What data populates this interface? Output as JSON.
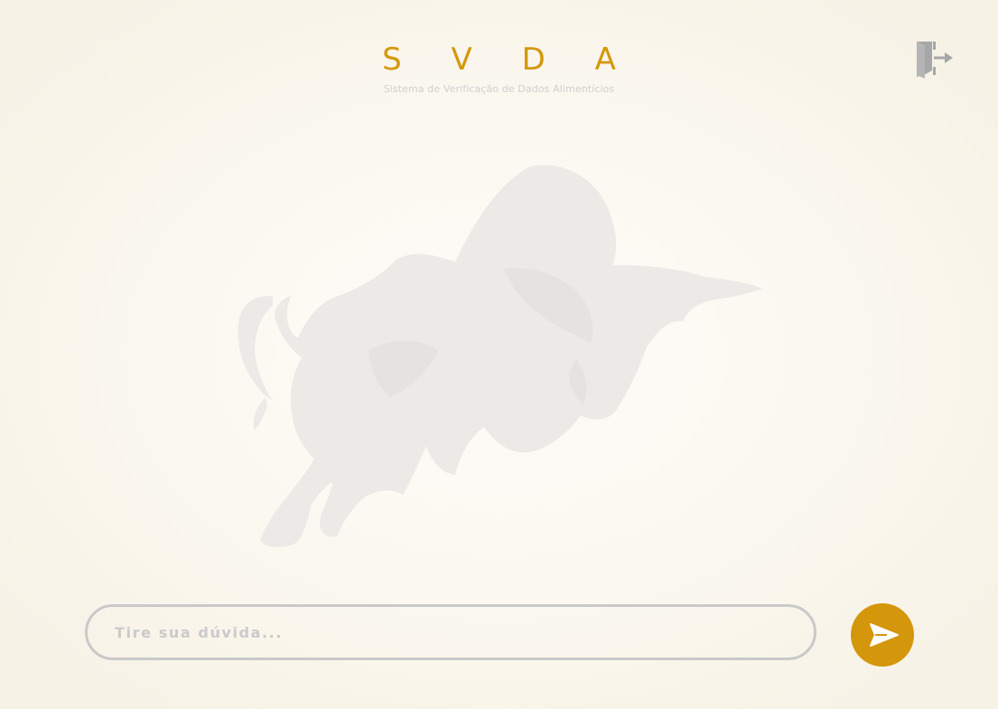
{
  "header": {
    "title": "S V D A",
    "subtitle": "Sistema de Verificação de Dados Alimentícios"
  },
  "chat": {
    "placeholder": "Tire sua dúvida...",
    "value": ""
  },
  "icons": {
    "logout": "logout-door-icon",
    "send": "send-arrow-icon",
    "watermark": "bull-watermark-icon"
  },
  "colors": {
    "accent": "#d4960a",
    "background": "#fbf8f0",
    "input_border": "#c9c9c9",
    "placeholder": "#cacaca",
    "subtitle": "#cfcfcf",
    "watermark": "#e9e8e5"
  }
}
